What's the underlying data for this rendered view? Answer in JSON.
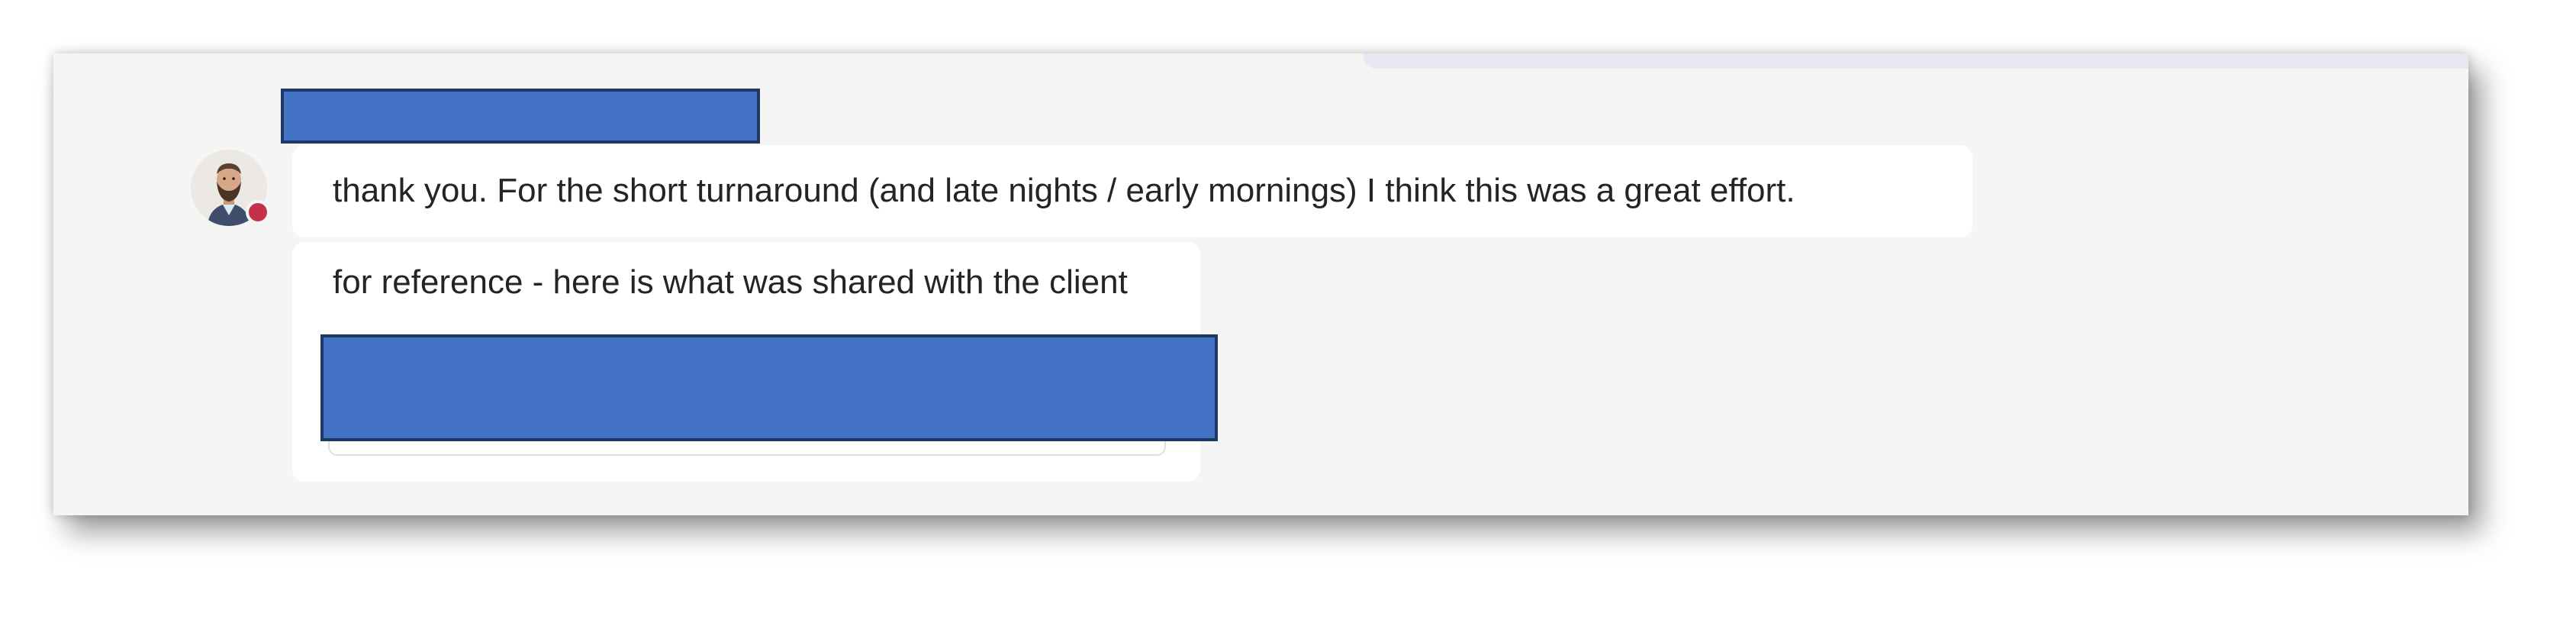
{
  "conversation": {
    "messages": [
      {
        "sender_name_redacted": true,
        "presence_status": "busy",
        "text": "thank you.  For the short turnaround (and late nights / early mornings) I think this was a great effort."
      },
      {
        "text": "for reference - here is what was shared with the client",
        "attachment_redacted": true
      }
    ]
  },
  "colors": {
    "redaction_fill": "#4472c4",
    "redaction_border": "#1f3864",
    "presence_busy": "#c4314b",
    "chat_background": "#f5f5f5",
    "bubble_background": "#ffffff"
  },
  "icons": {
    "avatar": "user-avatar-photo",
    "presence": "presence-busy-dot"
  }
}
